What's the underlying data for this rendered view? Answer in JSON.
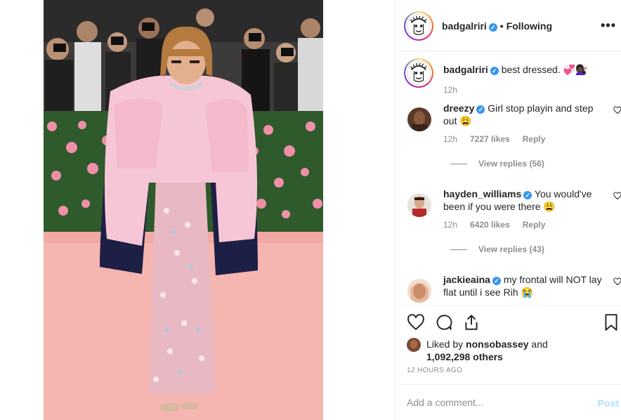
{
  "post": {
    "username": "badgalriri",
    "follow_status": "Following",
    "separator": "•",
    "more_icon": "more-options-icon",
    "caption_text": "best dressed.",
    "caption_emoji": "💞💇🏿‍♀️",
    "caption_time": "12h"
  },
  "comments": [
    {
      "username": "dreezy",
      "text": "Girl stop playin and step out",
      "emoji": "😩",
      "time": "12h",
      "likes": "7227 likes",
      "reply_label": "Reply",
      "view_replies": "View replies (56)"
    },
    {
      "username": "hayden_williams",
      "text": "You would've been if you were there",
      "emoji": "😩",
      "time": "12h",
      "likes": "6420 likes",
      "reply_label": "Reply",
      "view_replies": "View replies (43)"
    },
    {
      "username": "jackieaina",
      "text": "my frontal will NOT lay flat until i see Rih",
      "emoji": "😭"
    }
  ],
  "likes": {
    "prefix": "Liked by",
    "user": "nonsobassey",
    "middle": "and",
    "count": "1,092,298 others"
  },
  "timestamp": "12 HOURS AGO",
  "add_comment": {
    "placeholder": "Add a comment...",
    "post_label": "Post"
  },
  "colors": {
    "verified": "#3897f0",
    "post_disabled": "#b2dffc",
    "muted": "#8e8e8e",
    "carpet": "#f5b5b0",
    "feather_pink": "#f7c6d6",
    "feather_navy": "#1e1f45"
  }
}
